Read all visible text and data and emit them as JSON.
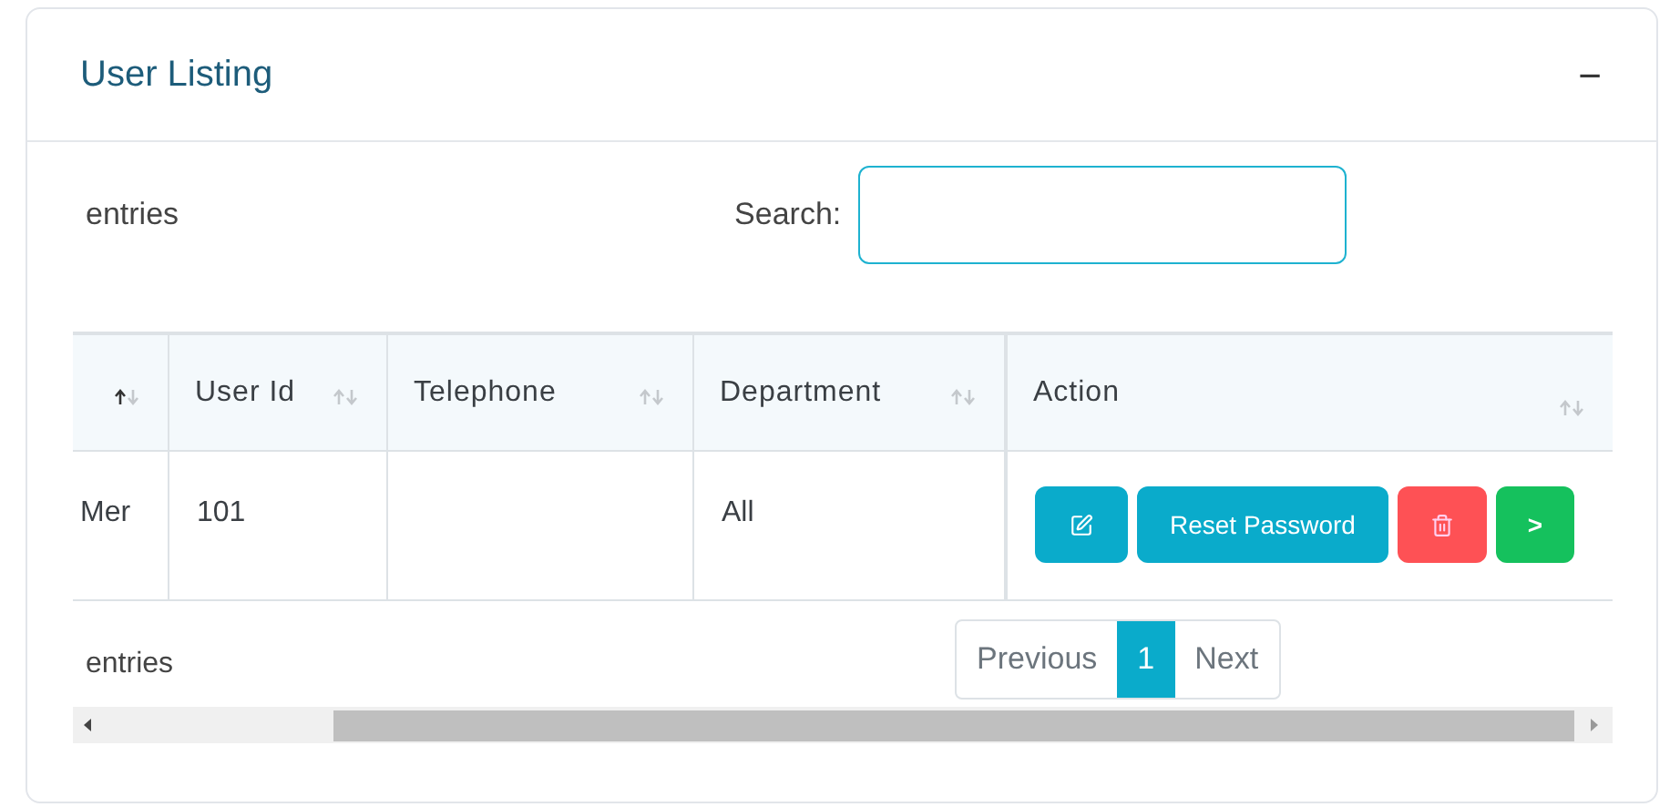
{
  "card": {
    "title": "User Listing",
    "collapse_icon": "−"
  },
  "length_text": "entries",
  "search": {
    "label": "Search:"
  },
  "table": {
    "columns": [
      {
        "sorted": true
      },
      {
        "label": "User Id",
        "sorted": false
      },
      {
        "label": "Telephone",
        "sorted": false
      },
      {
        "label": "Department",
        "sorted": false
      },
      {
        "label": "Action",
        "sorted": false
      }
    ],
    "rows": [
      {
        "cells": [
          "Mer",
          "101",
          null,
          "All"
        ],
        "actions": [
          {
            "kind": "edit"
          },
          {
            "kind": "text",
            "label": "Reset Password"
          },
          {
            "kind": "delete"
          },
          {
            "kind": "next",
            "label": ">"
          }
        ]
      }
    ]
  },
  "info_text": "entries",
  "pagination": [
    {
      "label": "Previous",
      "selected": false
    },
    {
      "label": "1",
      "selected": true
    },
    {
      "label": "Next",
      "selected": false
    }
  ]
}
